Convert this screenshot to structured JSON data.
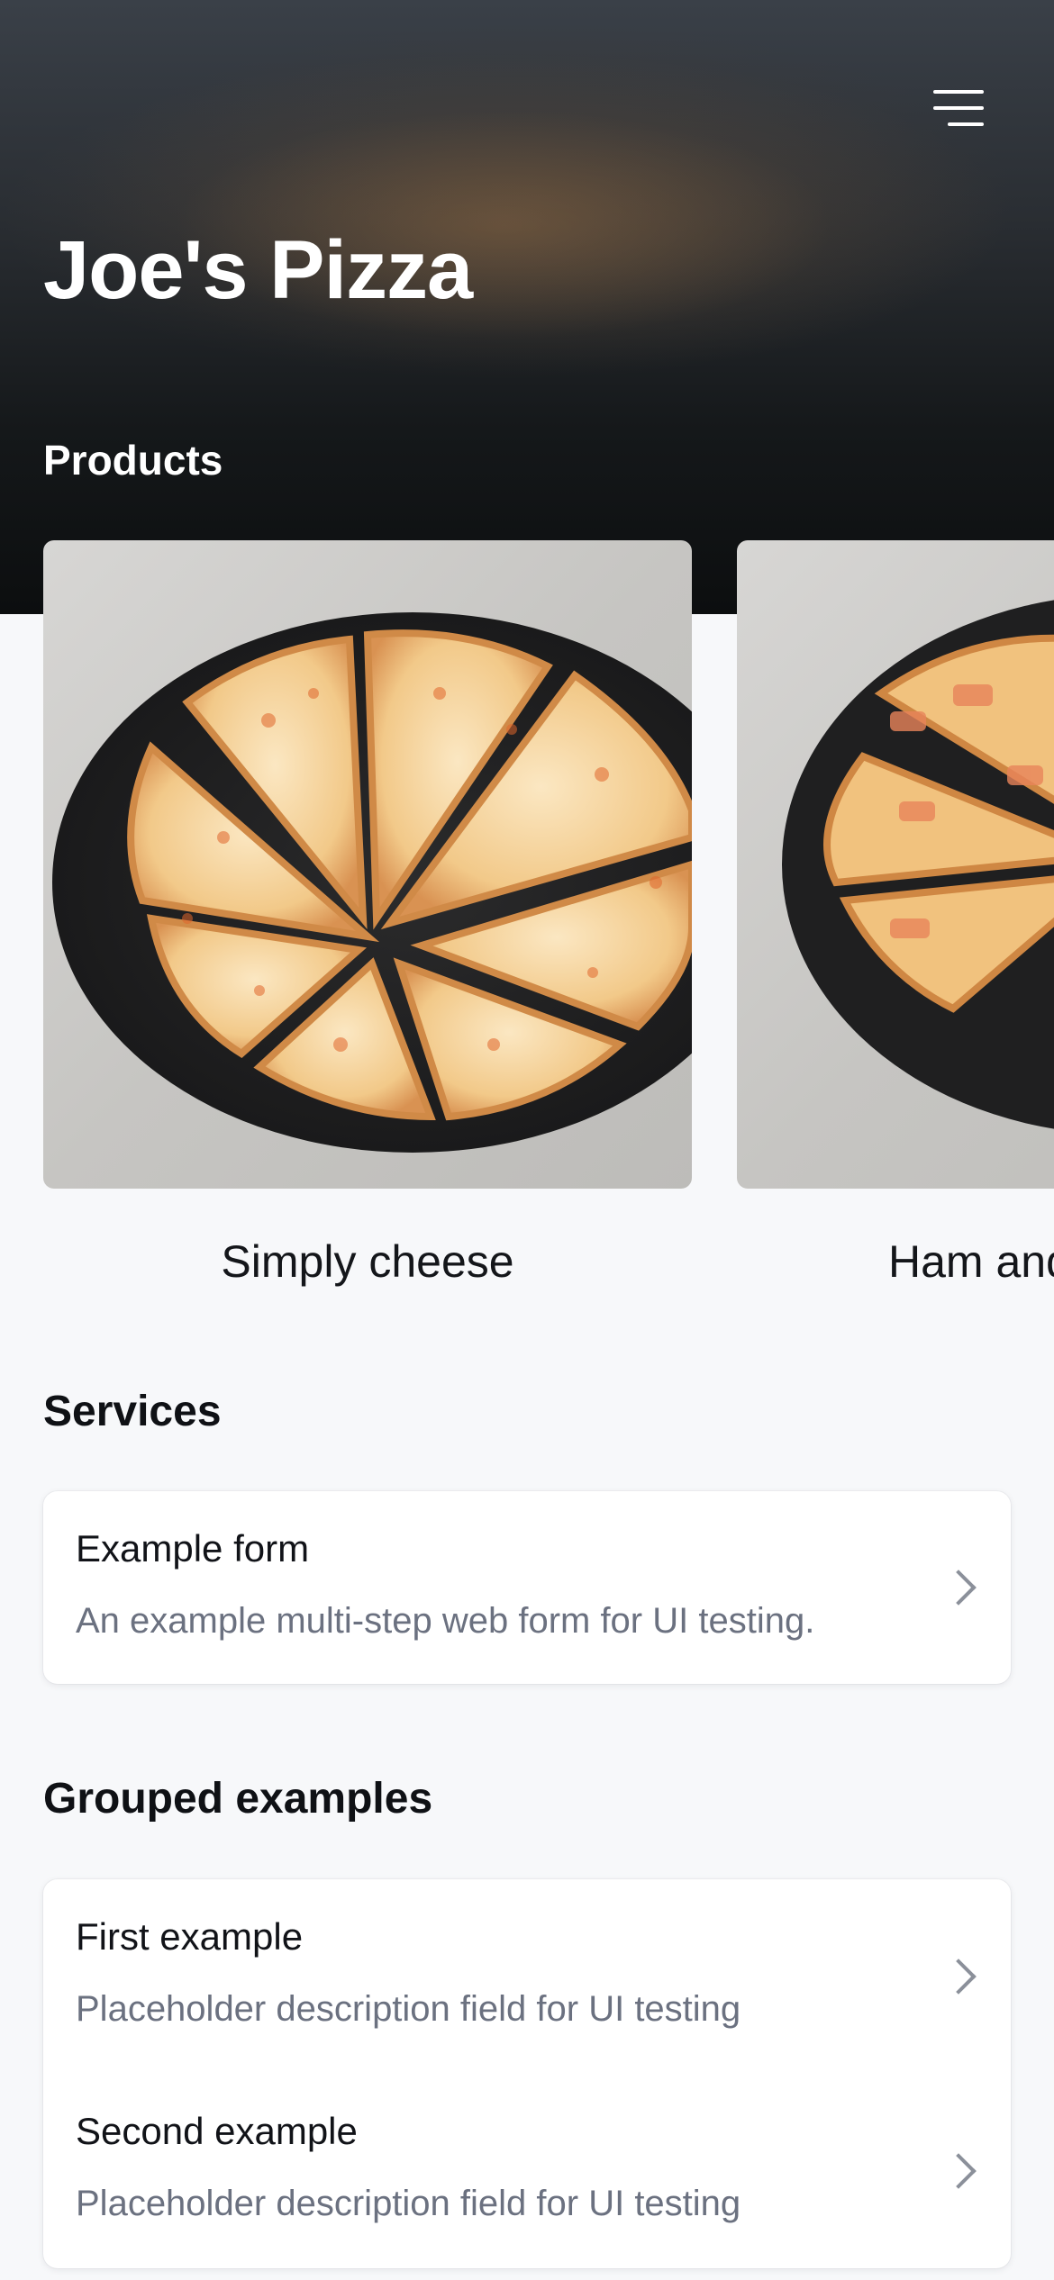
{
  "app": {
    "brand": "Joe's Pizza"
  },
  "header": {
    "menu_icon": "hamburger-menu-icon"
  },
  "products": {
    "heading": "Products",
    "items": [
      {
        "name": "Simply cheese"
      },
      {
        "name": "Ham and"
      }
    ]
  },
  "services": {
    "heading": "Services",
    "items": [
      {
        "title": "Example form",
        "description": "An example multi-step web form for UI testing."
      }
    ]
  },
  "grouped": {
    "heading": "Grouped examples",
    "items": [
      {
        "title": "First example",
        "description": "Placeholder description field for UI testing"
      },
      {
        "title": "Second example",
        "description": "Placeholder description field for UI testing"
      }
    ]
  },
  "colors": {
    "background": "#f7f8fa",
    "text": "#111318",
    "muted": "#6b7180",
    "card": "#ffffff"
  }
}
